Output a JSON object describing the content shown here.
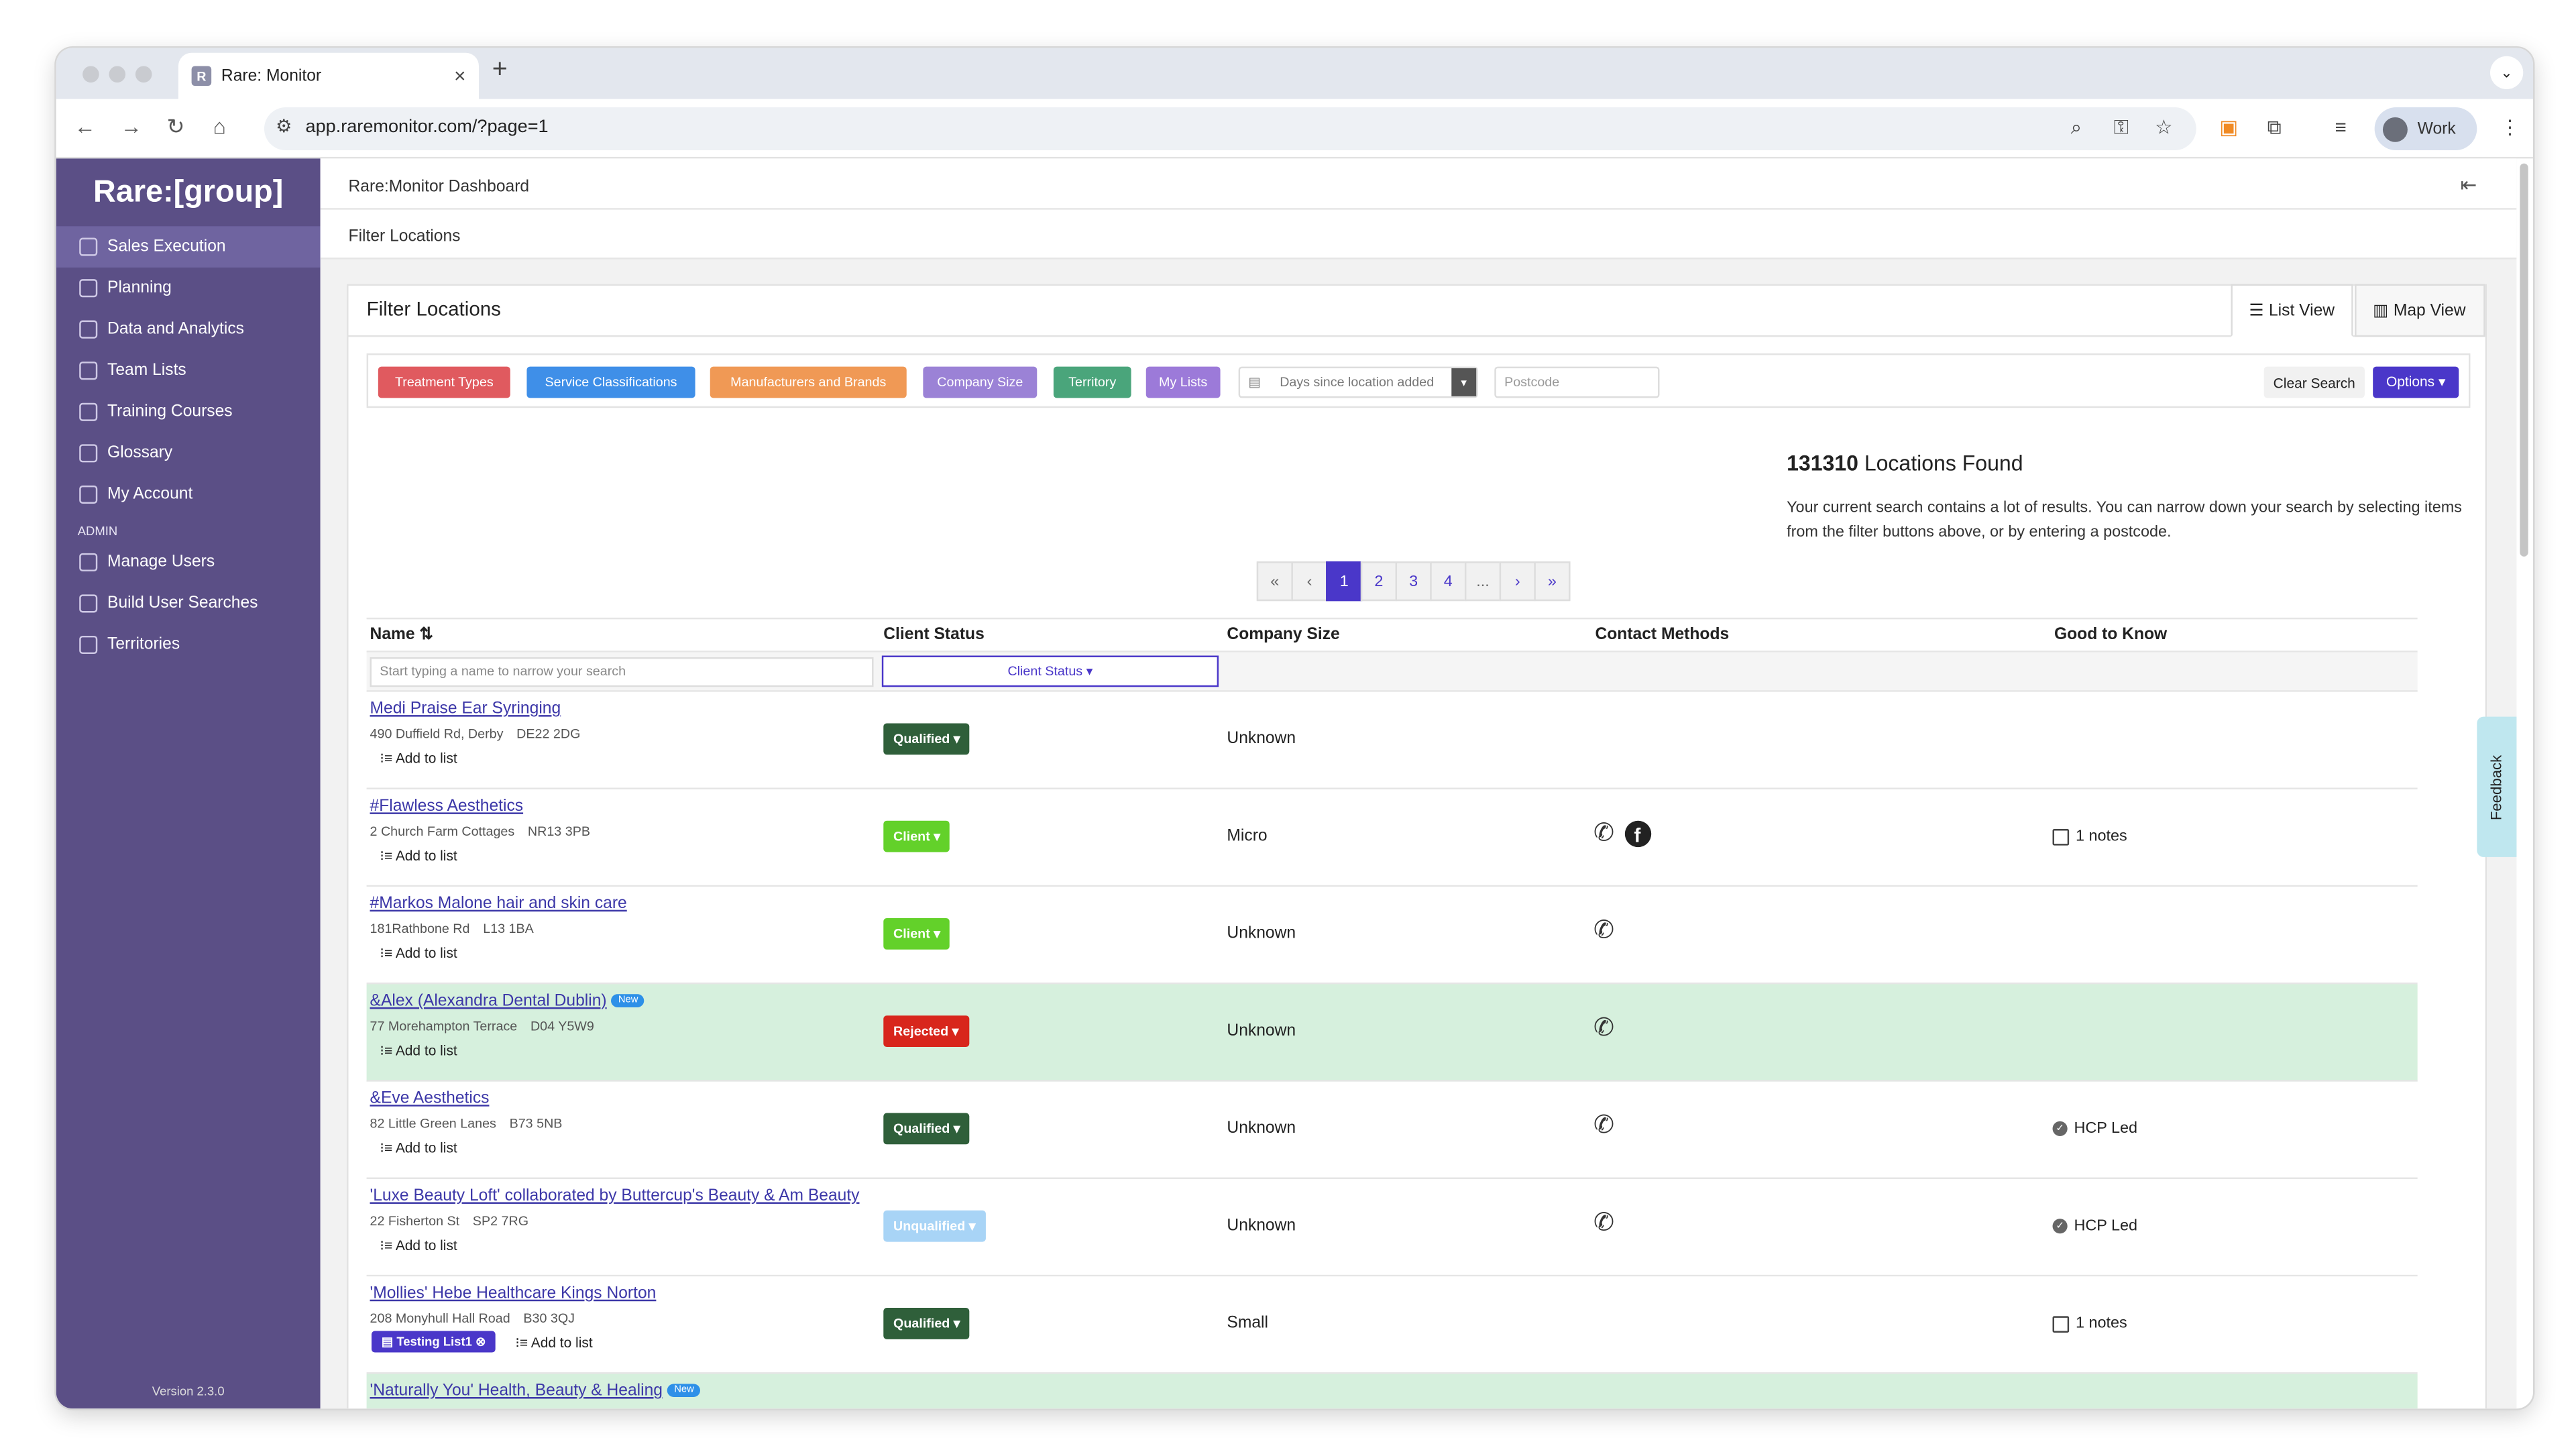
{
  "browser": {
    "tab_title": "Rare: Monitor",
    "favicon_letter": "R",
    "url": "app.raremonitor.com/?page=1",
    "profile_label": "Work"
  },
  "sidebar": {
    "logo": "Rare:[group]",
    "items": [
      {
        "label": "Sales Execution",
        "icon": "grid-icon"
      },
      {
        "label": "Planning",
        "icon": "calendar-icon"
      },
      {
        "label": "Data and Analytics",
        "icon": "chart-icon"
      },
      {
        "label": "Team Lists",
        "icon": "list-icon"
      },
      {
        "label": "Training Courses",
        "icon": "book-icon"
      },
      {
        "label": "Glossary",
        "icon": "glossary-icon"
      },
      {
        "label": "My Account",
        "icon": "at-icon"
      }
    ],
    "admin_section": "ADMIN",
    "admin_items": [
      {
        "label": "Manage Users",
        "icon": "users-icon"
      },
      {
        "label": "Build User Searches",
        "icon": "search-icon"
      },
      {
        "label": "Territories",
        "icon": "tag-icon"
      }
    ],
    "version": "Version 2.3.0"
  },
  "header": {
    "dashboard_title": "Rare:Monitor Dashboard",
    "section_title": "Filter Locations"
  },
  "card": {
    "title": "Filter Locations",
    "list_view": "List View",
    "map_view": "Map View"
  },
  "filters": {
    "chips": [
      {
        "label": "Treatment Types",
        "color": "#e05a5f"
      },
      {
        "label": "Service Classifications",
        "color": "#3f8fe8"
      },
      {
        "label": "Manufacturers and Brands",
        "color": "#f09955"
      },
      {
        "label": "Company Size",
        "color": "#9b82d6"
      },
      {
        "label": "Territory",
        "color": "#4aa57b"
      },
      {
        "label": "My Lists",
        "color": "#9c7ad9"
      }
    ],
    "days_placeholder": "Days since location added",
    "postcode_placeholder": "Postcode",
    "clear_label": "Clear Search",
    "options_label": "Options ▾"
  },
  "results": {
    "count": "131310",
    "count_suffix": " Locations Found",
    "note": "Your current search contains a lot of results. You can narrow down your search by selecting items from the filter buttons above, or by entering a postcode."
  },
  "pagination": {
    "pages": [
      "«",
      "‹",
      "1",
      "2",
      "3",
      "4",
      "...",
      "›",
      "»"
    ],
    "current": "1"
  },
  "table": {
    "headers": {
      "name": "Name ⇅",
      "status": "Client Status",
      "size": "Company Size",
      "contact": "Contact Methods",
      "good": "Good to Know"
    },
    "name_placeholder": "Start typing a name to narrow your search",
    "status_filter": "Client Status ▾",
    "add_to_list": "⁝≡ Add to list",
    "rows": [
      {
        "name": "Medi Praise Ear Syringing",
        "new": "",
        "address": "490 Duffield Rd, Derby",
        "postcode": "DE22 2DG",
        "status": "Qualified ▾",
        "status_color": "#2f5f3a",
        "size": "Unknown",
        "phone": "",
        "facebook": "",
        "good": "",
        "list_badge": ""
      },
      {
        "name": "#Flawless Aesthetics",
        "new": "",
        "address": "2 Church Farm Cottages",
        "postcode": "NR13 3PB",
        "status": "Client ▾",
        "status_color": "#63d12a",
        "size": "Micro",
        "phone": "✆",
        "facebook": "f",
        "good": "1 notes",
        "list_badge": ""
      },
      {
        "name": "#Markos Malone hair and skin care",
        "new": "",
        "address": "181Rathbone Rd",
        "postcode": "L13 1BA",
        "status": "Client ▾",
        "status_color": "#63d12a",
        "size": "Unknown",
        "phone": "✆",
        "facebook": "",
        "good": "",
        "list_badge": ""
      },
      {
        "name": "&Alex (Alexandra Dental Dublin)",
        "new": "New",
        "address": "77 Morehampton Terrace",
        "postcode": "D04 Y5W9",
        "status": "Rejected ▾",
        "status_color": "#d8261c",
        "size": "Unknown",
        "phone": "✆",
        "facebook": "",
        "good": "",
        "list_badge": ""
      },
      {
        "name": "&Eve Aesthetics",
        "new": "",
        "address": "82 Little Green Lanes",
        "postcode": "B73 5NB",
        "status": "Qualified ▾",
        "status_color": "#2f5f3a",
        "size": "Unknown",
        "phone": "✆",
        "facebook": "",
        "good": "HCP Led",
        "list_badge": ""
      },
      {
        "name": "'Luxe Beauty Loft' collaborated by Buttercup's Beauty & Am Beauty",
        "new": "",
        "address": "22 Fisherton St",
        "postcode": "SP2 7RG",
        "status": "Unqualified ▾",
        "status_color": "#a8d4f6",
        "size": "Unknown",
        "phone": "✆",
        "facebook": "",
        "good": "HCP Led",
        "list_badge": ""
      },
      {
        "name": "'Mollies' Hebe Healthcare Kings Norton",
        "new": "",
        "address": "208 Monyhull Hall Road",
        "postcode": "B30 3QJ",
        "status": "Qualified ▾",
        "status_color": "#2f5f3a",
        "size": "Small",
        "phone": "",
        "facebook": "",
        "good": "1 notes",
        "list_badge": "▤ Testing List1 ⊗"
      },
      {
        "name": "'Naturally You' Health, Beauty & Healing",
        "new": "New",
        "address": "",
        "postcode": "",
        "status": "",
        "status_color": "",
        "size": "",
        "phone": "",
        "facebook": "",
        "good": "",
        "list_badge": ""
      }
    ]
  },
  "feedback_label": "Feedback"
}
